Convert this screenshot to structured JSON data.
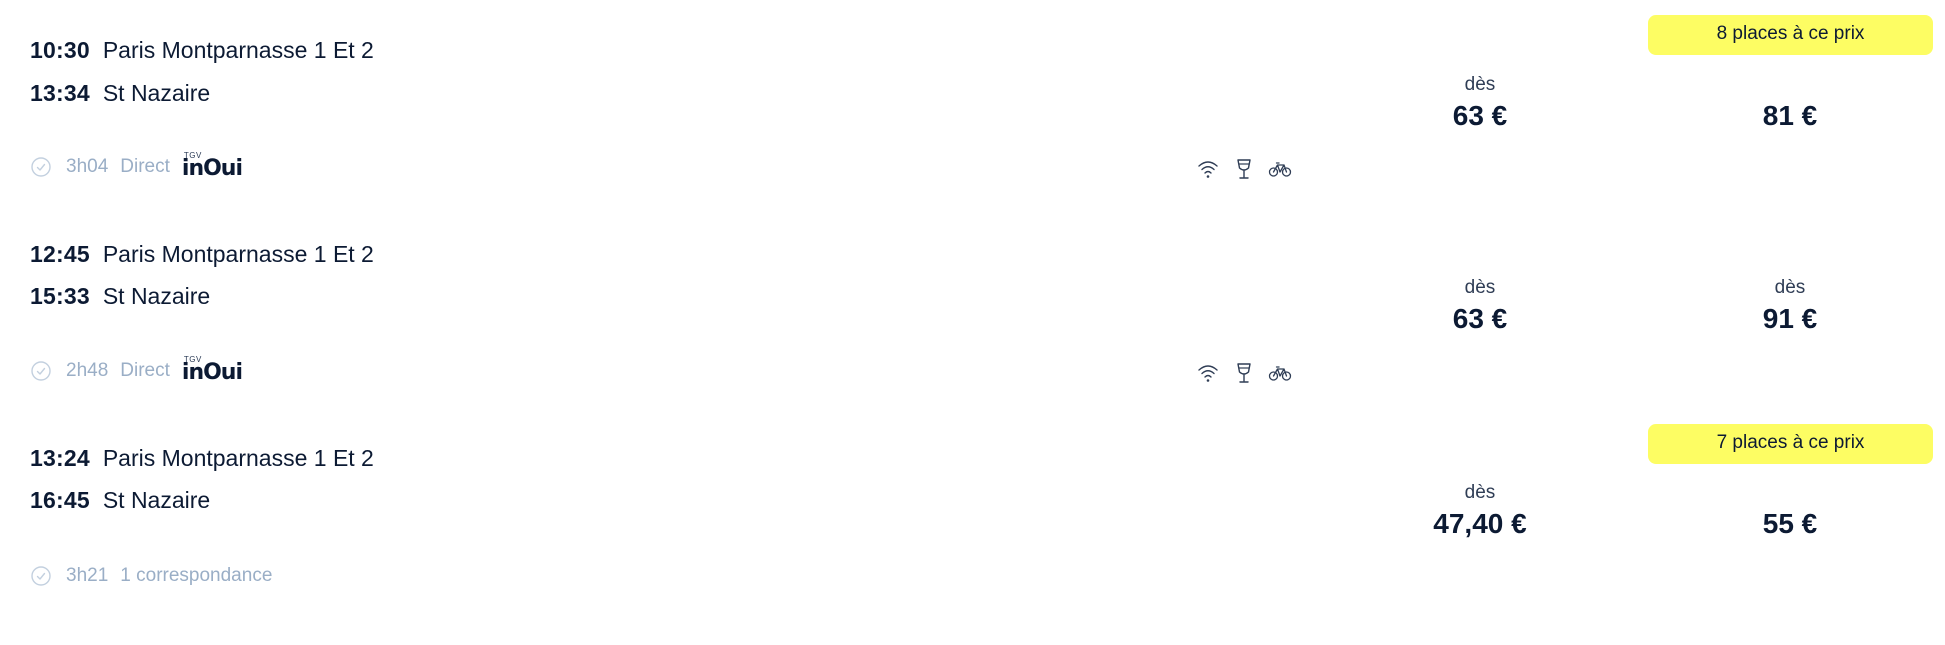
{
  "journeys": [
    {
      "departure_time": "10:30",
      "departure_station": "Paris Montparnasse 1 Et 2",
      "arrival_time": "13:34",
      "arrival_station": "St Nazaire",
      "duration": "3h04",
      "connection": "Direct",
      "train_brand": {
        "small": "TGV",
        "name": "inOui"
      },
      "services": [
        "wifi-icon",
        "bar-icon",
        "bike-icon"
      ],
      "second_class": {
        "prefix": "dès",
        "price": "63 €"
      },
      "first_class": {
        "prefix": "",
        "price": "81 €"
      },
      "badge": "8 places à ce prix"
    },
    {
      "departure_time": "12:45",
      "departure_station": "Paris Montparnasse 1 Et 2",
      "arrival_time": "15:33",
      "arrival_station": "St Nazaire",
      "duration": "2h48",
      "connection": "Direct",
      "train_brand": {
        "small": "TGV",
        "name": "inOui"
      },
      "services": [
        "wifi-icon",
        "bar-icon",
        "bike-icon"
      ],
      "second_class": {
        "prefix": "dès",
        "price": "63 €"
      },
      "first_class": {
        "prefix": "dès",
        "price": "91 €"
      },
      "badge": ""
    },
    {
      "departure_time": "13:24",
      "departure_station": "Paris Montparnasse 1 Et 2",
      "arrival_time": "16:45",
      "arrival_station": "St Nazaire",
      "duration": "3h21",
      "connection": "1 correspondance",
      "train_brand": {
        "small": "",
        "name": ""
      },
      "services": [],
      "second_class": {
        "prefix": "dès",
        "price": "47,40 €"
      },
      "first_class": {
        "prefix": "",
        "price": "55 €"
      },
      "badge": "7 places à ce prix"
    }
  ],
  "colors": {
    "text": "#0c1a33",
    "muted": "#9aaec6",
    "badge_bg": "#fdfd63"
  }
}
